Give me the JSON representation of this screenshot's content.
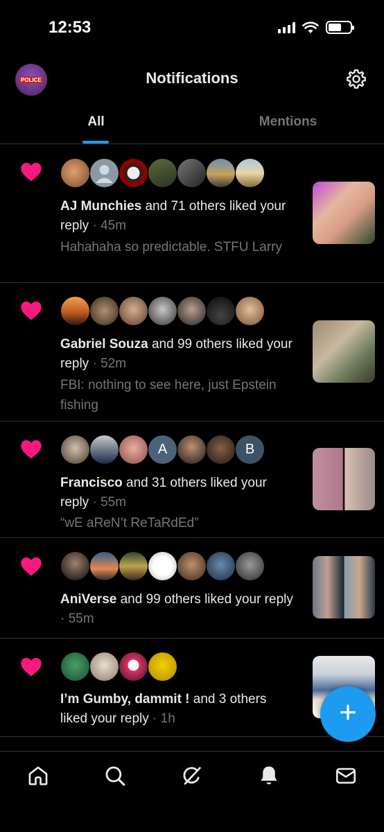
{
  "status_bar": {
    "time": "12:53"
  },
  "header": {
    "title": "Notifications",
    "profile_avatar_text": "POLICE"
  },
  "tabs": [
    {
      "label": "All",
      "active": true
    },
    {
      "label": "Mentions",
      "active": false
    }
  ],
  "notifications": [
    {
      "name": "AJ Munchies",
      "rest": " and 71 others liked your reply",
      "time": " · 45m",
      "snippet": "Hahahaha so predictable.   STFU Larry"
    },
    {
      "name": "Gabriel Souza",
      "rest": " and 99 others liked your reply",
      "time": " · 52m",
      "snippet": "FBI: nothing to see here, just Epstein fishing"
    },
    {
      "name": "Francisco",
      "rest": " and 31 others liked your reply",
      "time": " · 55m",
      "snippet": "“wE aReN’t ReTaRdEd”"
    },
    {
      "name": "AniVerse",
      "rest": " and 99 others liked your reply",
      "time": " · 55m",
      "snippet": ""
    },
    {
      "name": "I’m Gumby, dammit !",
      "rest": " and 3 others liked your reply",
      "time": " · 1h",
      "snippet": ""
    }
  ],
  "avatar_letters": {
    "a": "A",
    "b": "B"
  },
  "fab": {
    "label": "+"
  },
  "colors": {
    "accent": "#1d9bf0",
    "like": "#f91880",
    "muted": "#71767b",
    "divider": "#2f3336"
  },
  "icons": [
    "gear-icon",
    "heart-icon",
    "home-icon",
    "search-icon",
    "grok-icon",
    "bell-icon",
    "mail-icon"
  ]
}
